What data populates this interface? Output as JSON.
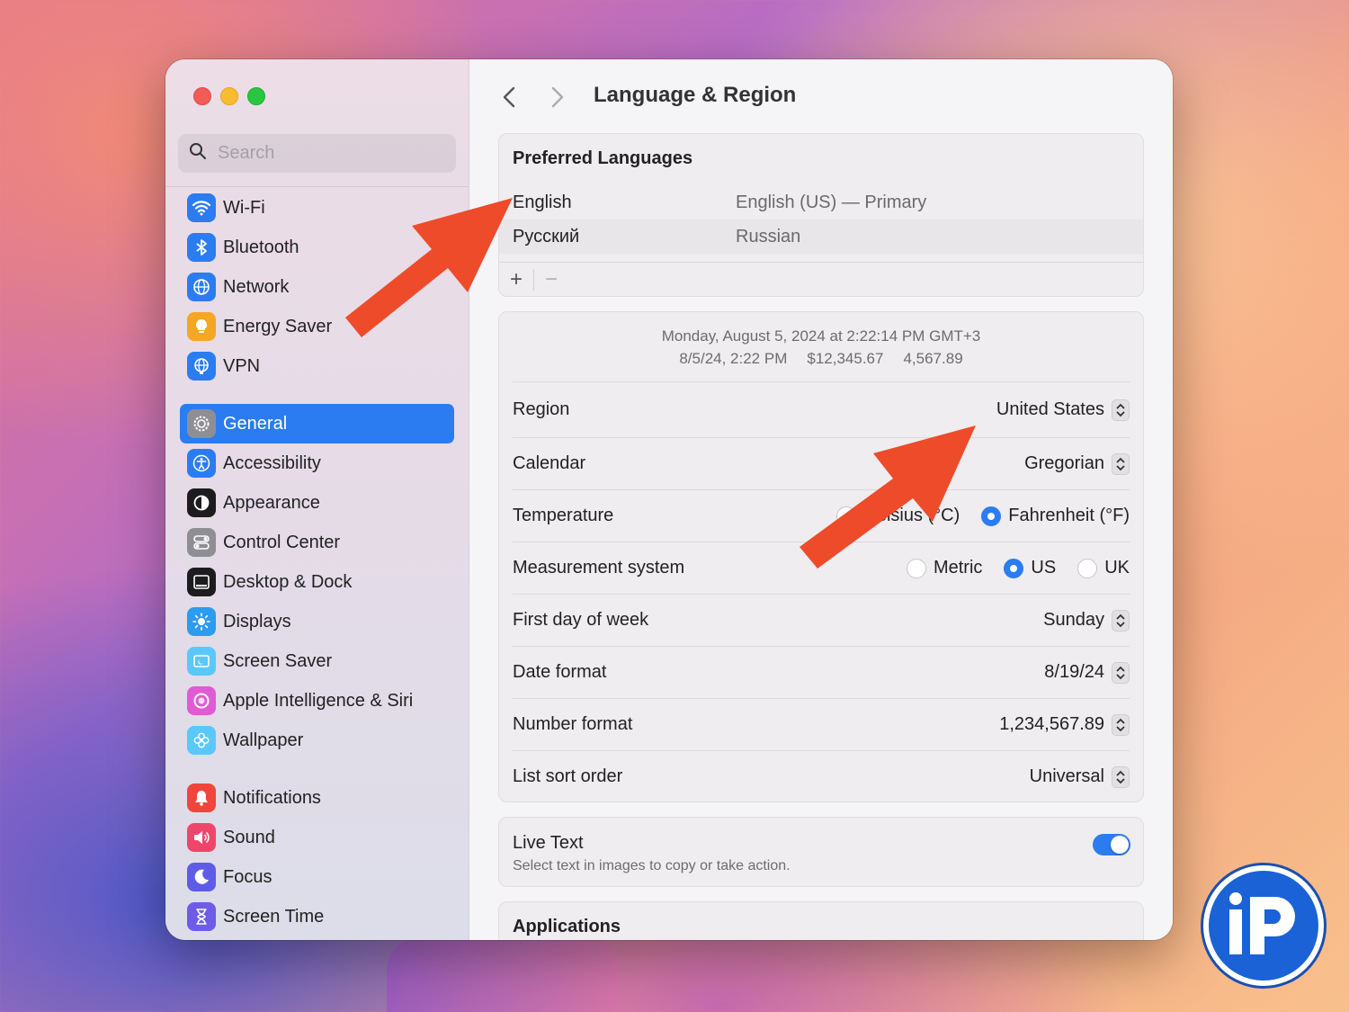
{
  "window": {
    "title": "Language & Region"
  },
  "sidebar": {
    "search_placeholder": "Search",
    "groups": [
      [
        {
          "label": "Wi-Fi",
          "icon": "wifi-icon",
          "color": "#2b7cf0"
        },
        {
          "label": "Bluetooth",
          "icon": "bluetooth-icon",
          "color": "#2b7cf0"
        },
        {
          "label": "Network",
          "icon": "globe-icon",
          "color": "#2b7cf0"
        },
        {
          "label": "Energy Saver",
          "icon": "lightbulb-icon",
          "color": "#f5a623"
        },
        {
          "label": "VPN",
          "icon": "vpn-globe-icon",
          "color": "#2b7cf0"
        }
      ],
      [
        {
          "label": "General",
          "icon": "gear-icon",
          "color": "#8e8e93",
          "selected": true
        },
        {
          "label": "Accessibility",
          "icon": "accessibility-icon",
          "color": "#2b7cf0"
        },
        {
          "label": "Appearance",
          "icon": "appearance-icon",
          "color": "#1c1c1e"
        },
        {
          "label": "Control Center",
          "icon": "control-center-icon",
          "color": "#8e8e93"
        },
        {
          "label": "Desktop & Dock",
          "icon": "dock-icon",
          "color": "#1c1c1e"
        },
        {
          "label": "Displays",
          "icon": "sun-icon",
          "color": "#2b9cf0"
        },
        {
          "label": "Screen Saver",
          "icon": "screen-saver-icon",
          "color": "#5ac8fa"
        },
        {
          "label": "Apple Intelligence & Siri",
          "icon": "siri-icon",
          "color": "#e05bd3"
        },
        {
          "label": "Wallpaper",
          "icon": "flower-icon",
          "color": "#5ac8fa"
        }
      ],
      [
        {
          "label": "Notifications",
          "icon": "bell-icon",
          "color": "#f0453c"
        },
        {
          "label": "Sound",
          "icon": "speaker-icon",
          "color": "#f0456a"
        },
        {
          "label": "Focus",
          "icon": "moon-icon",
          "color": "#5e5ce6"
        },
        {
          "label": "Screen Time",
          "icon": "hourglass-icon",
          "color": "#6e5ce6"
        }
      ]
    ]
  },
  "preferred_languages": {
    "title": "Preferred Languages",
    "items": [
      {
        "name": "English",
        "detail": "English (US) — Primary"
      },
      {
        "name": "Русский",
        "detail": "Russian"
      }
    ],
    "add_label": "+",
    "remove_label": "−"
  },
  "region_section": {
    "preview_line1": "Monday, August 5, 2024 at 2:22:14 PM GMT+3",
    "preview_date": "8/5/24, 2:22 PM",
    "preview_currency": "$12,345.67",
    "preview_number": "4,567.89",
    "region": {
      "label": "Region",
      "value": "United States"
    },
    "calendar": {
      "label": "Calendar",
      "value": "Gregorian"
    },
    "temperature": {
      "label": "Temperature",
      "options": [
        {
          "label": "Celsius (°C)",
          "selected": false
        },
        {
          "label": "Fahrenheit (°F)",
          "selected": true
        }
      ]
    },
    "measurement": {
      "label": "Measurement system",
      "options": [
        {
          "label": "Metric",
          "selected": false
        },
        {
          "label": "US",
          "selected": true
        },
        {
          "label": "UK",
          "selected": false
        }
      ]
    },
    "first_day": {
      "label": "First day of week",
      "value": "Sunday"
    },
    "date_format": {
      "label": "Date format",
      "value": "8/19/24"
    },
    "number_format": {
      "label": "Number format",
      "value": "1,234,567.89"
    },
    "list_sort": {
      "label": "List sort order",
      "value": "Universal"
    }
  },
  "live_text": {
    "title": "Live Text",
    "subtitle": "Select text in images to copy or take action.",
    "enabled": true
  },
  "applications": {
    "title": "Applications"
  },
  "colors": {
    "accent": "#2b7cf0",
    "annotation_arrow": "#ee4b2b"
  },
  "watermark": "iP"
}
